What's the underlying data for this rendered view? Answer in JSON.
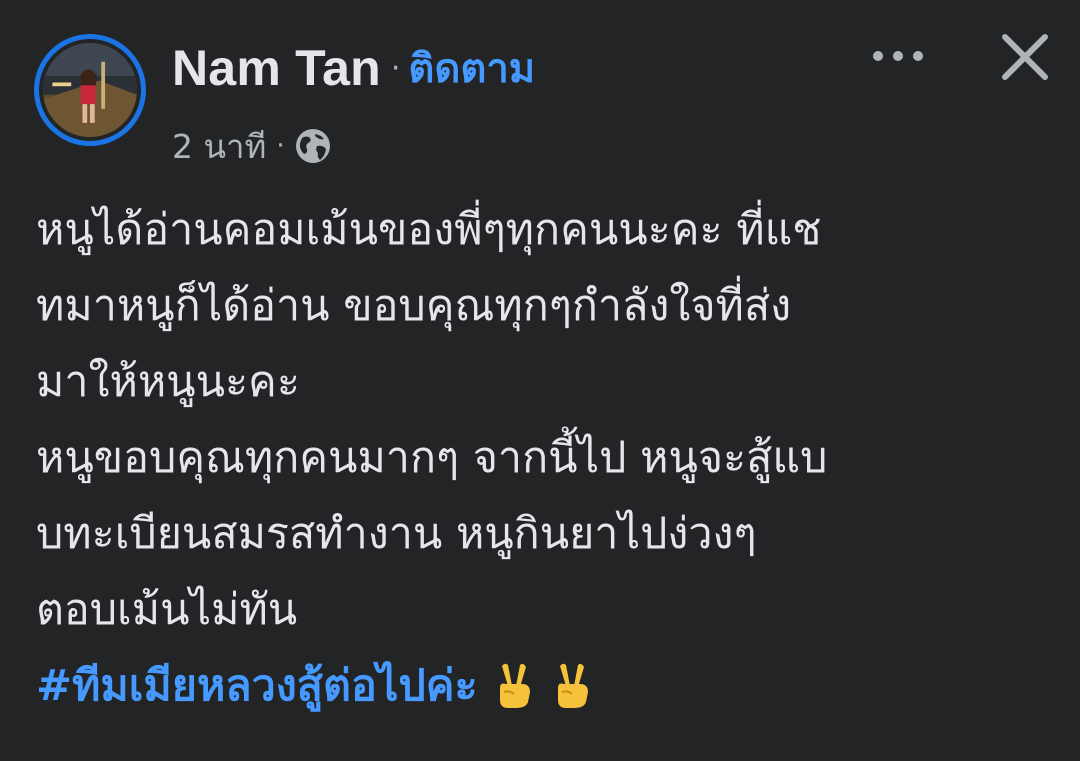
{
  "post": {
    "author": {
      "name": "Nam Tan",
      "follow_label": "ติดตาม",
      "separator": "·"
    },
    "meta": {
      "timestamp": "2 นาที",
      "separator": "·",
      "audience_icon": "globe-icon"
    },
    "header_actions": {
      "more_icon": "more-horizontal-icon",
      "close_icon": "close-icon"
    },
    "body_lines": [
      "หนูได้อ่านคอมเม้นของพี่ๆทุกคนนะคะ ที่แช",
      "ทมาหนูก็ได้อ่าน ขอบคุณทุกๆกำลังใจที่ส่ง",
      "มาให้หนูนะคะ",
      "หนูขอบคุณทุกคนมากๆ จากนี้ไป หนูจะสู้แบ",
      "บทะเบียนสมรสทำงาน หนูกินยาไปง่วงๆ",
      "ตอบเม้นไม่ทัน"
    ],
    "hashtag": "#ทีมเมียหลวงสู้ต่อไปค่ะ",
    "emojis": [
      "victory-hand-emoji",
      "victory-hand-emoji"
    ]
  },
  "colors": {
    "background": "#232425",
    "text_primary": "#e4e6eb",
    "text_secondary": "#b0b3b8",
    "link": "#4599ff",
    "avatar_ring": "#1b74e4"
  }
}
